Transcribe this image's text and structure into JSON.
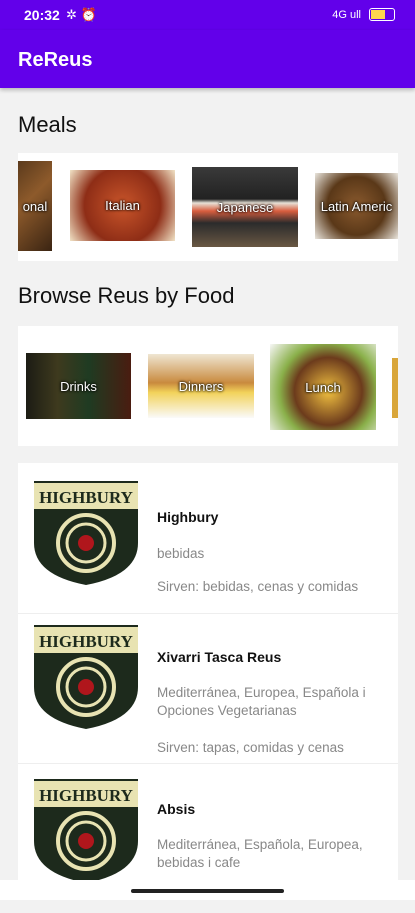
{
  "status": {
    "time": "20:32",
    "left_icons": "✲ ⏰",
    "signal_text": "4G ull",
    "battery": "59"
  },
  "app": {
    "title": "ReReus"
  },
  "meals": {
    "title": "Meals",
    "items": [
      {
        "label": "onal"
      },
      {
        "label": "Italian"
      },
      {
        "label": "Japanese"
      },
      {
        "label": "Latin Americ"
      }
    ]
  },
  "browse": {
    "title": "Browse Reus by Food",
    "items": [
      {
        "label": "Drinks"
      },
      {
        "label": "Dinners"
      },
      {
        "label": "Lunch"
      }
    ]
  },
  "restaurants": [
    {
      "logo_text": "HIGHBURY",
      "name": "Highbury",
      "category": "bebidas",
      "serves": "Sirven: bebidas, cenas y comidas"
    },
    {
      "logo_text": "HIGHBURY",
      "name": "Xivarri Tasca Reus",
      "category": "Mediterránea, Europea, Española i Opciones Vegetarianas",
      "serves": "Sirven: tapas, comidas y cenas"
    },
    {
      "logo_text": "HIGHBURY",
      "name": "Absis",
      "category": "Mediterránea, Española, Europea, bebidas i cafe",
      "serves": ""
    }
  ],
  "colors": {
    "primary": "#6200ea",
    "logo_green": "#1d2a1c",
    "logo_cream": "#e8e3b2",
    "logo_red": "#b0161c"
  }
}
